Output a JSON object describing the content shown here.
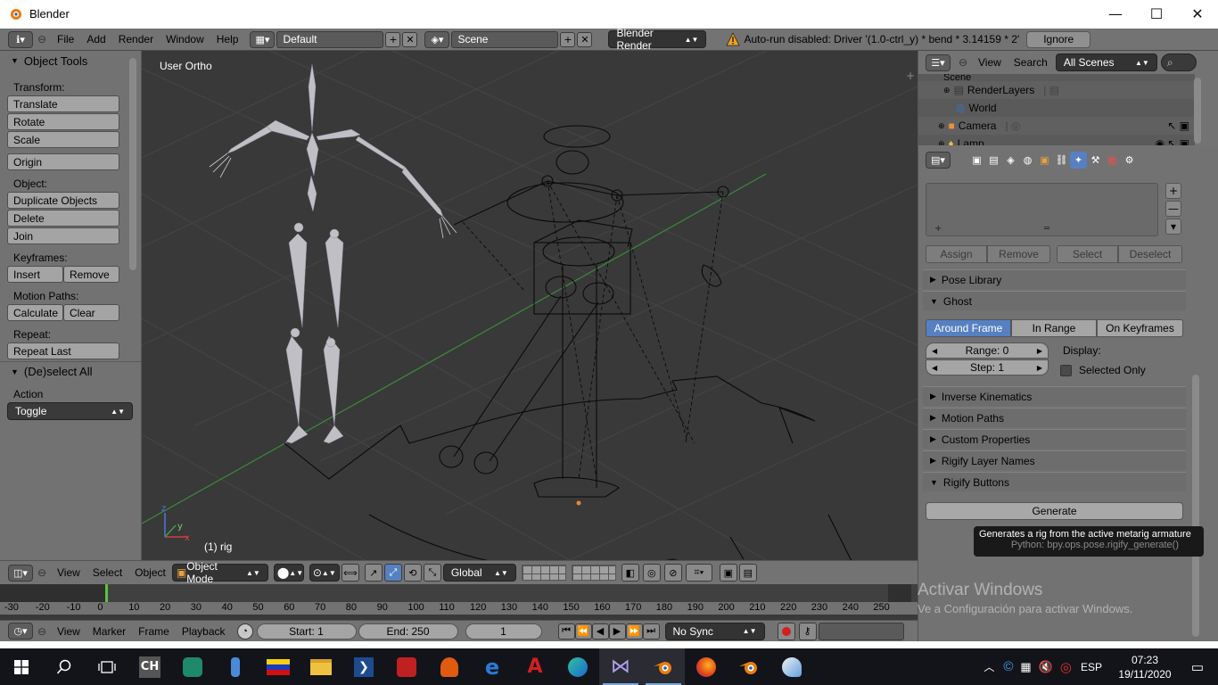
{
  "window": {
    "title": "Blender",
    "minimize": "—",
    "maximize": "☐",
    "close": "✕"
  },
  "topbar": {
    "menus": [
      "File",
      "Add",
      "Render",
      "Window",
      "Help"
    ],
    "layout": "Default",
    "scene": "Scene",
    "engine": "Blender Render",
    "warning": "Auto-run disabled: Driver '(1.0-ctrl_y) * bend * 3.14159 * 2'",
    "ignore": "Ignore"
  },
  "toolshelf": {
    "title": "Object Tools",
    "transform_label": "Transform:",
    "translate": "Translate",
    "rotate": "Rotate",
    "scale": "Scale",
    "origin": "Origin",
    "object_label": "Object:",
    "duplicate": "Duplicate Objects",
    "delete": "Delete",
    "join": "Join",
    "keyframes_label": "Keyframes:",
    "insert": "Insert",
    "remove": "Remove",
    "motion_paths_label": "Motion Paths:",
    "calculate": "Calculate",
    "clear": "Clear",
    "repeat_label": "Repeat:",
    "repeat_last": "Repeat Last",
    "deselect_title": "(De)select All",
    "action_label": "Action",
    "action_value": "Toggle"
  },
  "viewport": {
    "view_label": "User Ortho",
    "object_label": "(1) rig"
  },
  "vpheader": {
    "menus": [
      "View",
      "Select",
      "Object"
    ],
    "mode": "Object Mode",
    "orientation": "Global"
  },
  "timeline": {
    "ticks": [
      "-30",
      "-20",
      "-10",
      "0",
      "10",
      "20",
      "30",
      "40",
      "50",
      "60",
      "70",
      "80",
      "90",
      "100",
      "110",
      "120",
      "130",
      "140",
      "150",
      "160",
      "170",
      "180",
      "190",
      "200",
      "210",
      "220",
      "230",
      "240",
      "250"
    ],
    "menus": [
      "View",
      "Marker",
      "Frame",
      "Playback"
    ],
    "start": "Start: 1",
    "end": "End: 250",
    "current": "1",
    "sync": "No Sync"
  },
  "outliner": {
    "view": "View",
    "search": "Search",
    "filter": "All Scenes",
    "rows": [
      "Scene",
      "RenderLayers",
      "World",
      "Camera",
      "Lamp"
    ]
  },
  "props": {
    "assign": "Assign",
    "remove": "Remove",
    "select": "Select",
    "deselect": "Deselect",
    "pose_library": "Pose Library",
    "ghost": "Ghost",
    "ghost_modes": [
      "Around Frame",
      "In Range",
      "On Keyframes"
    ],
    "range": "Range: 0",
    "step": "Step: 1",
    "display_label": "Display:",
    "selected_only": "Selected Only",
    "inverse_kinematics": "Inverse Kinematics",
    "motion_paths": "Motion Paths",
    "custom_properties": "Custom Properties",
    "rigify_layer_names": "Rigify Layer Names",
    "rigify_buttons": "Rigify Buttons",
    "generate": "Generate"
  },
  "tooltip": {
    "text": "Generates a rig from the active metarig armature",
    "python": "Python: bpy.ops.pose.rigify_generate()"
  },
  "watermark": {
    "title": "Activar Windows",
    "subtitle": "Ve a Configuración para activar Windows."
  },
  "taskbar": {
    "lang": "ESP",
    "time": "07:23",
    "date": "19/11/2020",
    "accent": "#5680c2"
  }
}
